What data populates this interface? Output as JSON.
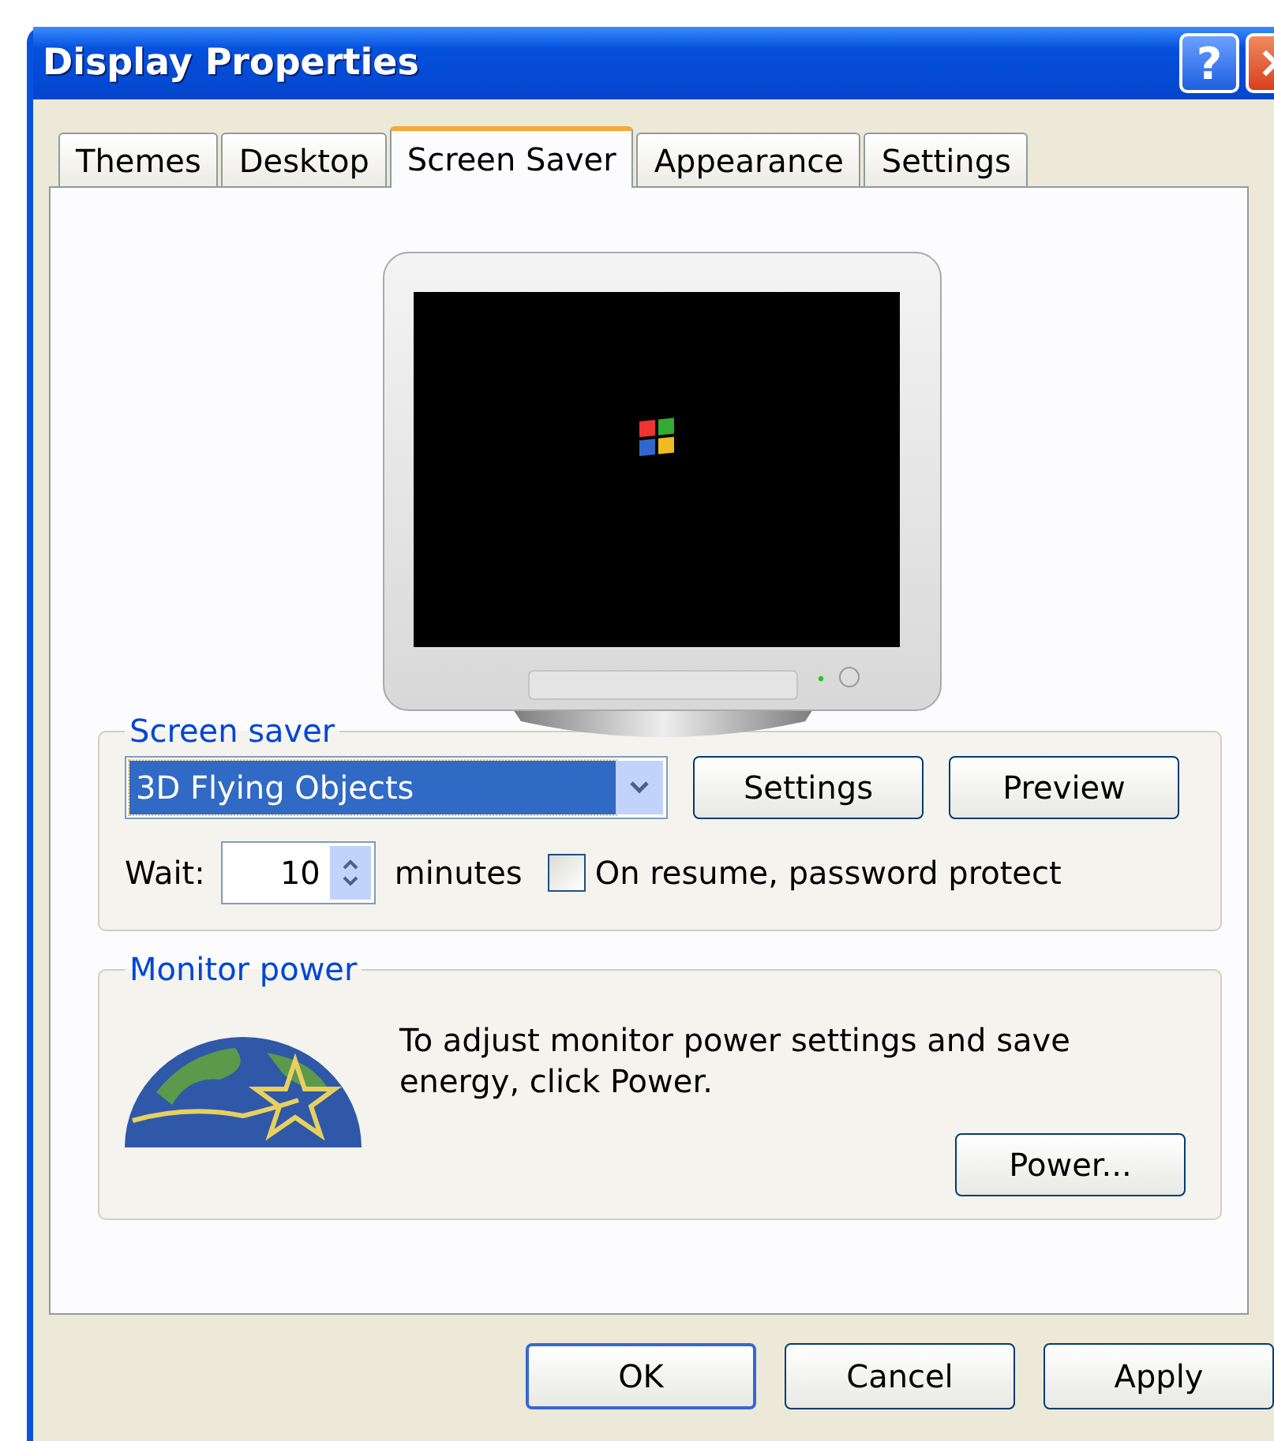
{
  "window": {
    "title": "Display Properties",
    "controls": [
      "?"
    ]
  },
  "tabs": [
    {
      "label": "Themes",
      "selected": false
    },
    {
      "label": "Desktop",
      "selected": false
    },
    {
      "label": "Screen Saver",
      "selected": true
    },
    {
      "label": "Appearance",
      "selected": false
    },
    {
      "label": "Settings",
      "selected": false
    }
  ],
  "screen_saver": {
    "legend": "Screen saver",
    "selected_saver": "3D Flying Objects",
    "buttons": [
      "Settings",
      "Preview"
    ],
    "wait_label": "Wait:",
    "wait_value": "10",
    "wait_unit": "minutes",
    "password_protect": {
      "label": "On resume, password protect",
      "checked": false
    }
  },
  "monitor_power": {
    "legend": "Monitor power",
    "text": "To adjust monitor power settings and save energy, click Power.",
    "button": "Power..."
  },
  "buttons": [
    "OK",
    "Cancel",
    "Apply"
  ]
}
